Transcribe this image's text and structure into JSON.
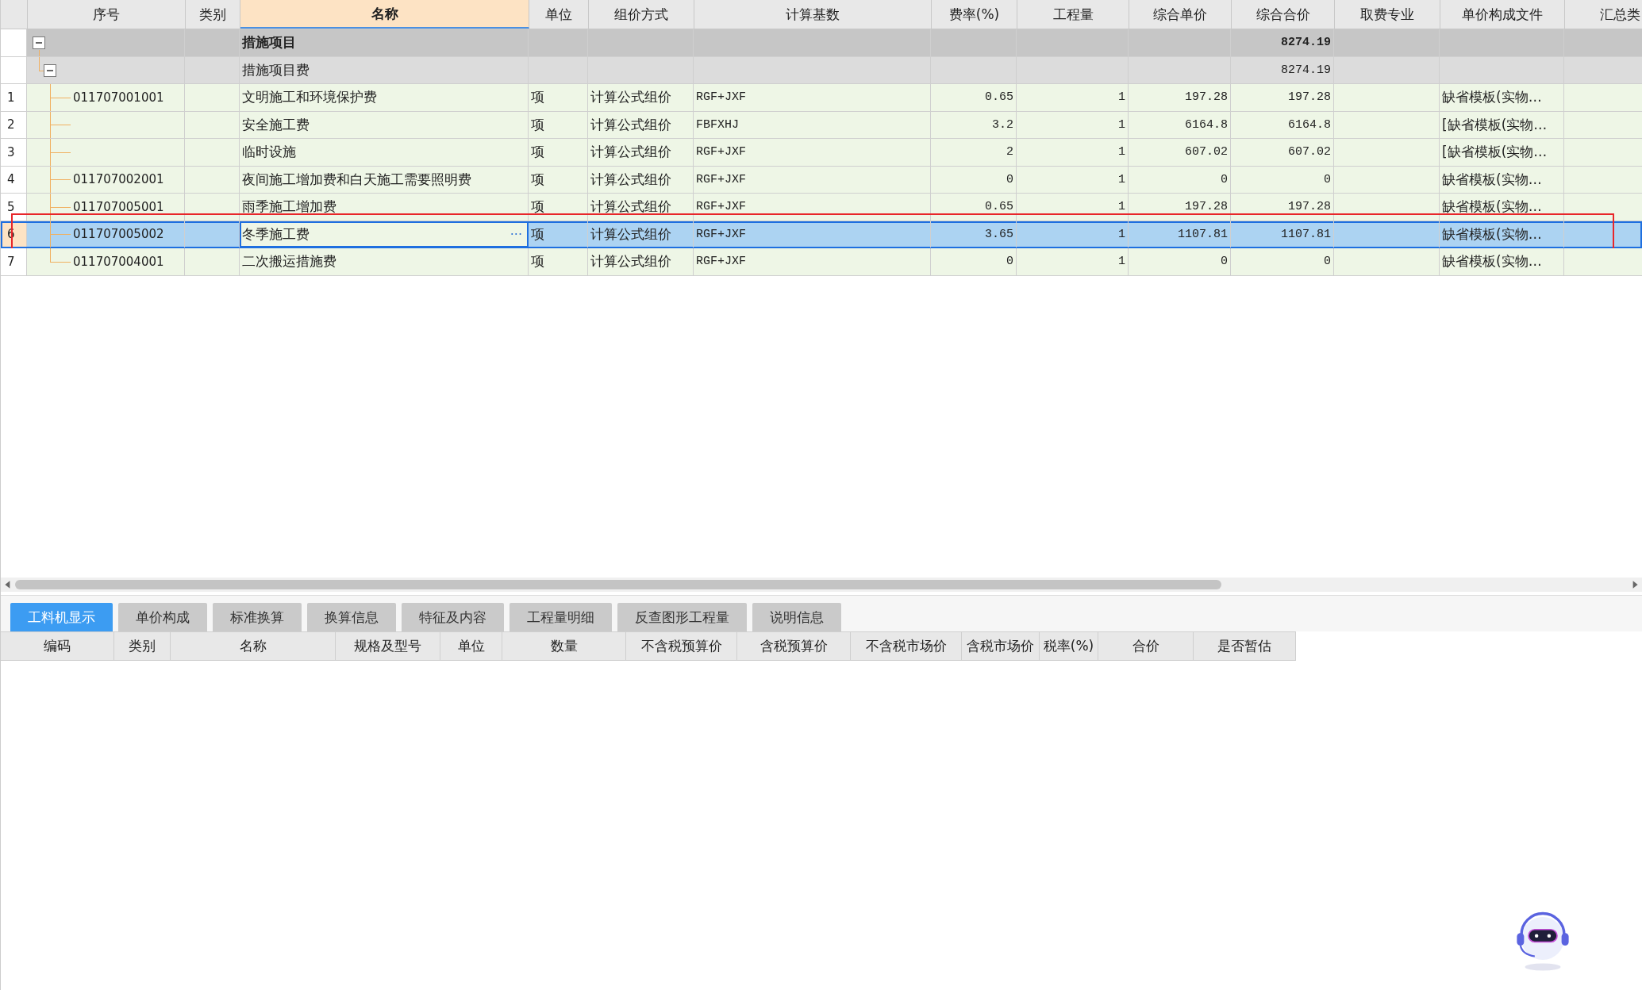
{
  "columns": [
    {
      "label": "序号",
      "selected": false
    },
    {
      "label": "类别",
      "selected": false
    },
    {
      "label": "名称",
      "selected": true
    },
    {
      "label": "单位",
      "selected": false
    },
    {
      "label": "组价方式",
      "selected": false
    },
    {
      "label": "计算基数",
      "selected": false
    },
    {
      "label": "费率(%)",
      "selected": false
    },
    {
      "label": "工程量",
      "selected": false
    },
    {
      "label": "综合单价",
      "selected": false
    },
    {
      "label": "综合合价",
      "selected": false
    },
    {
      "label": "取费专业",
      "selected": false
    },
    {
      "label": "单价构成文件",
      "selected": false
    },
    {
      "label": "汇总类",
      "selected": false
    }
  ],
  "rows": [
    {
      "kind": "group",
      "name": "措施项目",
      "total": "8274.19",
      "expanded": true,
      "children": [
        {
          "kind": "subgroup",
          "name": "措施项目费",
          "total": "8274.19",
          "expanded": true,
          "children": [
            {
              "kind": "item",
              "index": "1",
              "code": "011707001001",
              "name": "文明施工和环境保护费",
              "unit": "项",
              "method": "计算公式组价",
              "base": "RGF+JXF",
              "rate": "0.65",
              "qty": "1",
              "unit_price": "197.28",
              "total": "197.28",
              "template": "缺省模板(实物…",
              "selected": false,
              "marked": false
            },
            {
              "kind": "item",
              "index": "2",
              "name": "安全施工费",
              "unit": "项",
              "method": "计算公式组价",
              "base": "FBFXHJ",
              "rate": "3.2",
              "qty": "1",
              "unit_price": "6164.8",
              "total": "6164.8",
              "template": "[缺省模板(实物…",
              "selected": false,
              "marked": false
            },
            {
              "kind": "item",
              "index": "3",
              "name": "临时设施",
              "unit": "项",
              "method": "计算公式组价",
              "base": "RGF+JXF",
              "rate": "2",
              "qty": "1",
              "unit_price": "607.02",
              "total": "607.02",
              "template": "[缺省模板(实物…",
              "selected": false,
              "marked": false
            },
            {
              "kind": "item",
              "index": "4",
              "code": "011707002001",
              "name": "夜间施工增加费和白天施工需要照明费",
              "unit": "项",
              "method": "计算公式组价",
              "base": "RGF+JXF",
              "rate": "0",
              "qty": "1",
              "unit_price": "0",
              "total": "0",
              "template": "缺省模板(实物…",
              "selected": false,
              "marked": false
            },
            {
              "kind": "item",
              "index": "5",
              "code": "011707005001",
              "name": "雨季施工增加费",
              "unit": "项",
              "method": "计算公式组价",
              "base": "RGF+JXF",
              "rate": "0.65",
              "qty": "1",
              "unit_price": "197.28",
              "total": "197.28",
              "template": "缺省模板(实物…",
              "selected": false,
              "marked": false
            },
            {
              "kind": "item",
              "index": "6",
              "code": "011707005002",
              "name": "冬季施工费",
              "more": "···",
              "unit": "项",
              "method": "计算公式组价",
              "base": "RGF+JXF",
              "rate": "3.65",
              "qty": "1",
              "unit_price": "1107.81",
              "total": "1107.81",
              "template": "缺省模板(实物…",
              "selected": true,
              "marked": true
            },
            {
              "kind": "item",
              "index": "7",
              "code": "011707004001",
              "name": "二次搬运措施费",
              "unit": "项",
              "method": "计算公式组价",
              "base": "RGF+JXF",
              "rate": "0",
              "qty": "1",
              "unit_price": "0",
              "total": "0",
              "template": "缺省模板(实物…",
              "selected": false,
              "marked": false
            }
          ]
        }
      ]
    }
  ],
  "bottom_tabs": [
    {
      "label": "工料机显示",
      "selected": true
    },
    {
      "label": "单价构成",
      "selected": false
    },
    {
      "label": "标准换算",
      "selected": false
    },
    {
      "label": "换算信息",
      "selected": false
    },
    {
      "label": "特征及内容",
      "selected": false
    },
    {
      "label": "工程量明细",
      "selected": false
    },
    {
      "label": "反查图形工程量",
      "selected": false
    },
    {
      "label": "说明信息",
      "selected": false
    }
  ],
  "bottom_columns": [
    "编码",
    "类别",
    "名称",
    "规格及型号",
    "单位",
    "数量",
    "不含税预算价",
    "含税预算价",
    "不含税市场价",
    "含税市场价",
    "税率(%)",
    "合价",
    "是否暂估"
  ]
}
